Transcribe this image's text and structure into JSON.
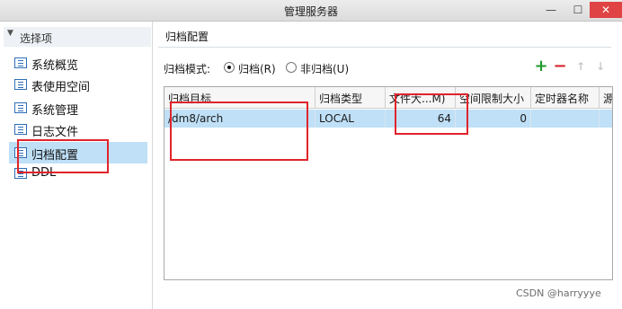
{
  "window": {
    "title": "管理服务器",
    "close": "✕",
    "minimize": "—",
    "maximize": "☐"
  },
  "sidebar": {
    "header": "选择项",
    "items": [
      {
        "label": "系统概览"
      },
      {
        "label": "表使用空间"
      },
      {
        "label": "系统管理"
      },
      {
        "label": "日志文件"
      },
      {
        "label": "归档配置",
        "selected": true
      },
      {
        "label": "DDL"
      }
    ]
  },
  "panel": {
    "title": "归档配置",
    "mode_label": "归档模式:",
    "mode_options": [
      {
        "label": "归档(R)",
        "checked": true
      },
      {
        "label": "非归档(U)",
        "checked": false
      }
    ],
    "toolbar": {
      "add": "+",
      "remove": "−",
      "up": "↑",
      "down": "↓"
    }
  },
  "table": {
    "columns": [
      "归档目标",
      "归档类型",
      "文件大...M)",
      "空间限制大小",
      "定时器名称",
      "源"
    ],
    "rows": [
      [
        "/dm8/arch",
        "LOCAL",
        "64",
        "0",
        "",
        ""
      ]
    ]
  },
  "watermark": "CSDN @harryyye",
  "colors": {
    "selection": "#bfe0f7",
    "annotation": "#e0242c",
    "add": "#1f9a2d",
    "remove": "#d6202a",
    "close": "#e04343"
  }
}
